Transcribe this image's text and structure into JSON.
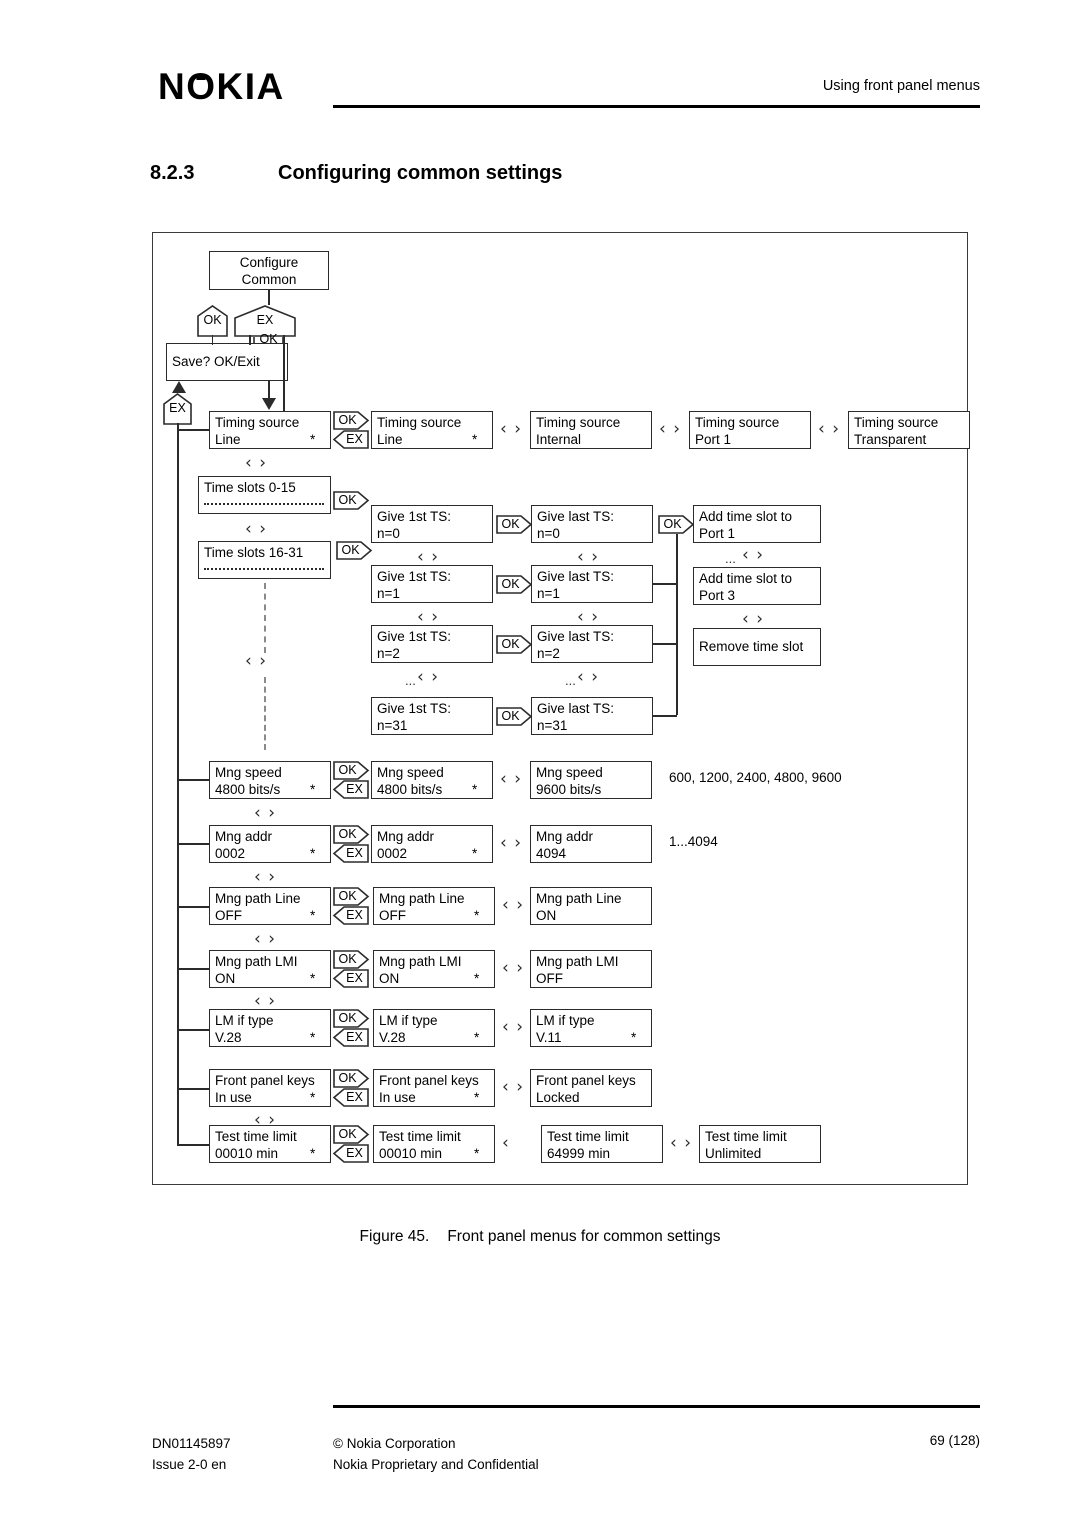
{
  "header": {
    "logo": "NOKIA",
    "running_head": "Using front panel menus"
  },
  "section": {
    "number": "8.2.3",
    "title": "Configuring common settings"
  },
  "figure": {
    "caption_number": "Figure 45.",
    "caption_text": "Front panel menus for common settings"
  },
  "footer": {
    "doc_id": "DN01145897",
    "issue": "Issue 2-0 en",
    "copyright": "© Nokia Corporation",
    "confidentiality": "Nokia Proprietary and Confidential",
    "page": "69 (128)"
  },
  "keys": {
    "ok": "OK",
    "ex": "EX"
  },
  "nav_symbol": "‹ ›",
  "ellipsis": "...",
  "diagram": {
    "root": {
      "line1": "Configure",
      "line2": "Common"
    },
    "save_prompt": "Save? OK/Exit",
    "timing_source": {
      "selected": {
        "line1": "Timing source",
        "line2": "Line",
        "star": "*"
      },
      "options": [
        {
          "line1": "Timing source",
          "line2": "Line",
          "star": "*"
        },
        {
          "line1": "Timing source",
          "line2": "Internal",
          "star": ""
        },
        {
          "line1": "Timing source",
          "line2": "Port 1",
          "star": ""
        },
        {
          "line1": "Timing source",
          "line2": "Transparent",
          "star": ""
        }
      ]
    },
    "time_slots": [
      {
        "label": "Time slots 0-15"
      },
      {
        "label": "Time slots 16-31"
      }
    ],
    "give_first_ts": [
      {
        "line1": "Give 1st TS:",
        "line2": "n=0"
      },
      {
        "line1": "Give 1st TS:",
        "line2": "n=1"
      },
      {
        "line1": "Give 1st TS:",
        "line2": "n=2"
      },
      {
        "line1": "Give 1st TS:",
        "line2": "n=31"
      }
    ],
    "give_last_ts": [
      {
        "line1": "Give last TS:",
        "line2": "n=0"
      },
      {
        "line1": "Give last TS:",
        "line2": "n=1"
      },
      {
        "line1": "Give last TS:",
        "line2": "n=2"
      },
      {
        "line1": "Give last TS:",
        "line2": "n=31"
      }
    ],
    "time_slot_actions": [
      {
        "line1": "Add time slot to",
        "line2": "Port 1"
      },
      {
        "line1": "Add time slot to",
        "line2": "Port 3"
      },
      {
        "line1": "Remove time slot",
        "line2": ""
      }
    ],
    "settings": [
      {
        "name": "mng-speed",
        "current": {
          "line1": "Mng speed",
          "line2": "4800 bits/s",
          "star": "*"
        },
        "edit": {
          "line1": "Mng speed",
          "line2": "4800 bits/s",
          "star": "*"
        },
        "alt": {
          "line1": "Mng speed",
          "line2": "9600 bits/s",
          "star": ""
        },
        "range": "600, 1200, 2400, 4800, 9600"
      },
      {
        "name": "mng-addr",
        "current": {
          "line1": "Mng addr",
          "line2": "0002",
          "star": "*"
        },
        "edit": {
          "line1": "Mng addr",
          "line2": "0002",
          "star": "*"
        },
        "alt": {
          "line1": "Mng addr",
          "line2": "4094",
          "star": ""
        },
        "range": "1...4094"
      },
      {
        "name": "mng-path-line",
        "current": {
          "line1": "Mng path Line",
          "line2": "OFF",
          "star": "*"
        },
        "edit": {
          "line1": "Mng path Line",
          "line2": "OFF",
          "star": "*"
        },
        "alt": {
          "line1": "Mng path Line",
          "line2": "ON",
          "star": ""
        },
        "range": ""
      },
      {
        "name": "mng-path-lmi",
        "current": {
          "line1": "Mng path LMI",
          "line2": "ON",
          "star": "*"
        },
        "edit": {
          "line1": "Mng path LMI",
          "line2": "ON",
          "star": "*"
        },
        "alt": {
          "line1": "Mng path LMI",
          "line2": "OFF",
          "star": ""
        },
        "range": ""
      },
      {
        "name": "lm-if-type",
        "current": {
          "line1": "LM if type",
          "line2": "V.28",
          "star": "*"
        },
        "edit": {
          "line1": "LM if type",
          "line2": "V.28",
          "star": "*"
        },
        "alt": {
          "line1": "LM if type",
          "line2": "V.11",
          "star": "*"
        },
        "range": ""
      },
      {
        "name": "front-panel-keys",
        "current": {
          "line1": "Front panel keys",
          "line2": "In use",
          "star": "*"
        },
        "edit": {
          "line1": "Front panel keys",
          "line2": "In use",
          "star": "*"
        },
        "alt": {
          "line1": "Front panel keys",
          "line2": "Locked",
          "star": ""
        },
        "range": ""
      }
    ],
    "test_time_limit": {
      "current": {
        "line1": "Test time limit",
        "line2": "00010 min",
        "star": "*"
      },
      "edit": {
        "line1": "Test time limit",
        "line2": "00010 min",
        "star": "*"
      },
      "max": {
        "line1": "Test time limit",
        "line2": "64999 min",
        "star": ""
      },
      "unlimited": {
        "line1": "Test time limit",
        "line2": "Unlimited",
        "star": ""
      }
    }
  }
}
